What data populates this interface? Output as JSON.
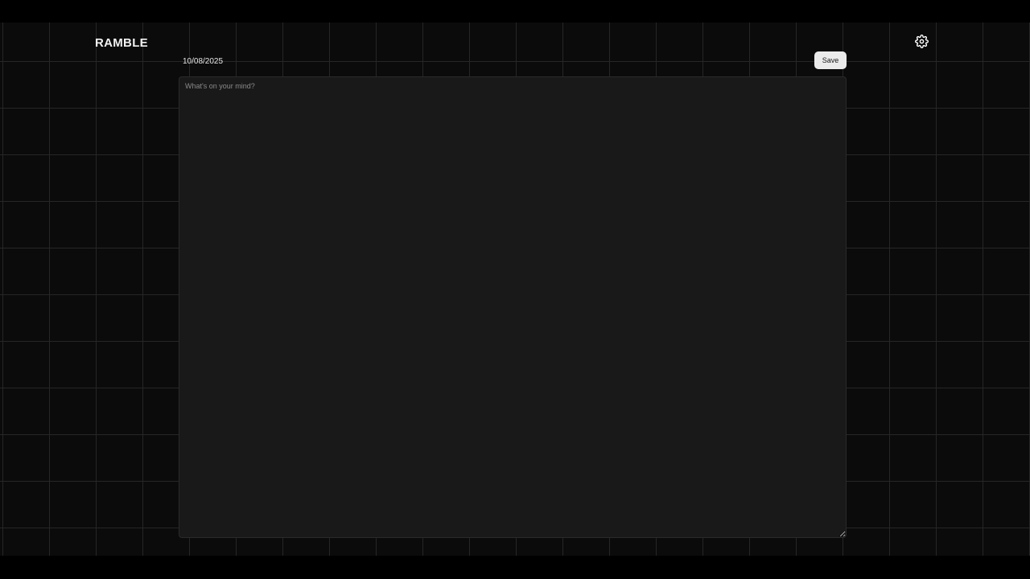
{
  "header": {
    "brand": "RAMBLE",
    "settings_icon": "gear-icon"
  },
  "entry": {
    "date": "10/08/2025",
    "save_label": "Save",
    "placeholder": "What's on your mind?",
    "value": ""
  },
  "colors": {
    "background": "#0b0b0b",
    "grid_line": "#262626",
    "editor_bg": "#191919",
    "text": "#f2f2f2",
    "save_bg": "#ebebeb"
  }
}
